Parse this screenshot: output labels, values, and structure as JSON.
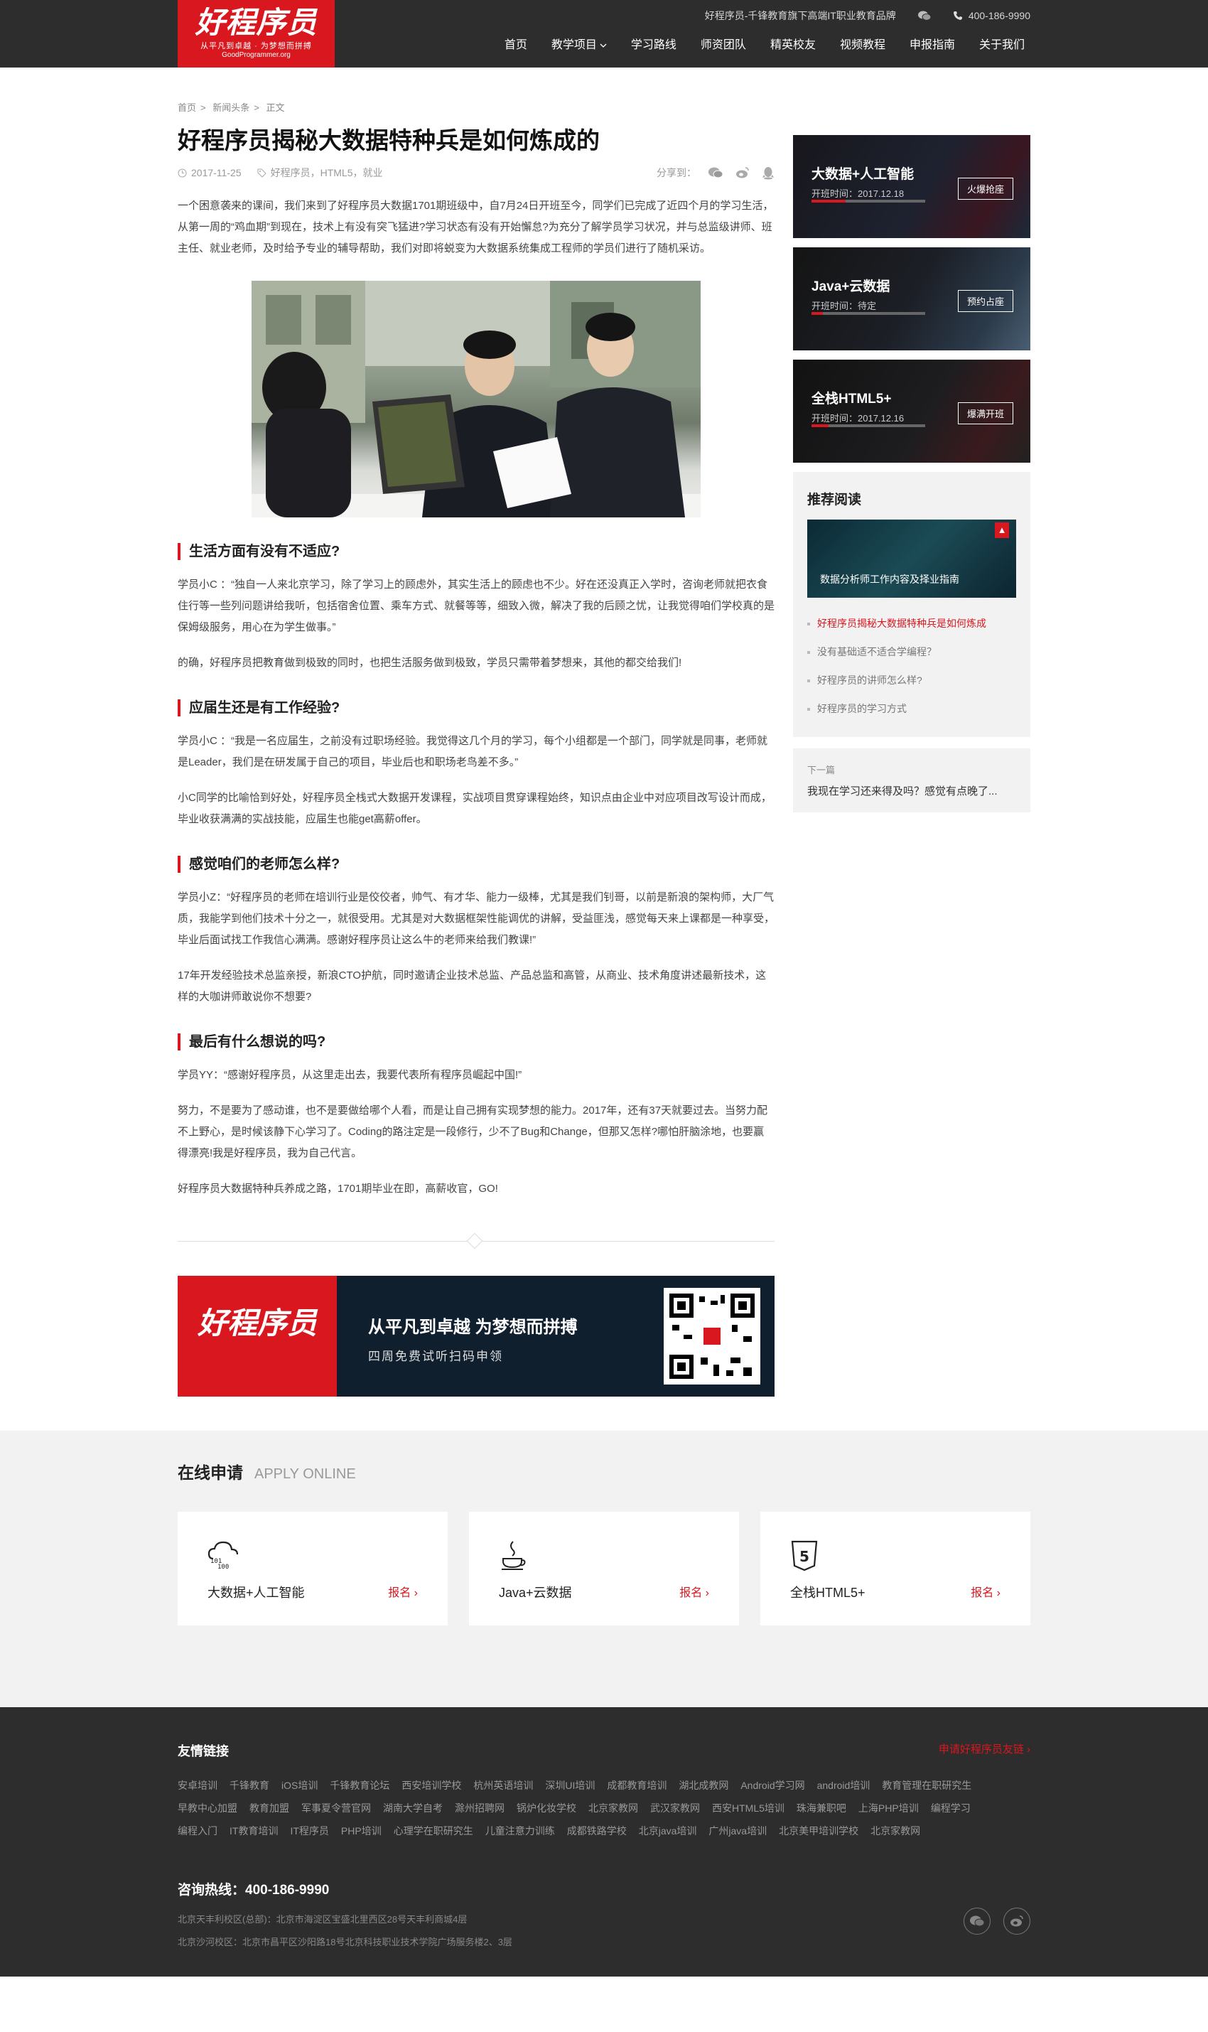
{
  "header": {
    "logo_text": "好程序员",
    "logo_slogan": "从平凡到卓越 · 为梦想而拼搏",
    "logo_url": "GoodProgrammer.org",
    "tagline": "好程序员-千锋教育旗下高端IT职业教育品牌",
    "phone": "400-186-9990",
    "nav": [
      "首页",
      "教学项目",
      "学习路线",
      "师资团队",
      "精英校友",
      "视频教程",
      "申报指南",
      "关于我们"
    ]
  },
  "breadcrumb": [
    "首页",
    "新闻头条",
    "正文"
  ],
  "article": {
    "title": "好程序员揭秘大数据特种兵是如何炼成的",
    "date": "2017-11-25",
    "tags": "好程序员，HTML5，就业",
    "share_label": "分享到：",
    "intro": "一个困意袭来的课间，我们来到了好程序员大数据1701期班级中，自7月24日开班至今，同学们已完成了近四个月的学习生活，从第一周的“鸡血期”到现在，技术上有没有突飞猛进?学习状态有没有开始懈怠?为充分了解学员学习状况，并与总监级讲师、班主任、就业老师，及时给予专业的辅导帮助，我们对即将蜕变为大数据系统集成工程师的学员们进行了随机采访。",
    "sections": [
      {
        "heading": "生活方面有没有不适应?",
        "paras": [
          "学员小C ：“独自一人来北京学习，除了学习上的顾虑外，其实生活上的顾虑也不少。好在还没真正入学时，咨询老师就把衣食住行等一些列问题讲给我听，包括宿舍位置、乘车方式、就餐等等，细致入微，解决了我的后顾之忧，让我觉得咱们学校真的是保姆级服务，用心在为学生做事。”",
          "的确，好程序员把教育做到极致的同时，也把生活服务做到极致，学员只需带着梦想来，其他的都交给我们!"
        ]
      },
      {
        "heading": "应届生还是有工作经验?",
        "paras": [
          "学员小C ：“我是一名应届生，之前没有过职场经验。我觉得这几个月的学习，每个小组都是一个部门，同学就是同事，老师就是Leader，我们是在研发属于自己的项目，毕业后也和职场老鸟差不多。”",
          "小C同学的比喻恰到好处，好程序员全栈式大数据开发课程，实战项目贯穿课程始终，知识点由企业中对应项目改写设计而成，毕业收获满满的实战技能，应届生也能get高薪offer。"
        ]
      },
      {
        "heading": "感觉咱们的老师怎么样?",
        "paras": [
          "学员小Z：“好程序员的老师在培训行业是佼佼者，帅气、有才华、能力一级棒，尤其是我们钊哥，以前是新浪的架构师，大厂气质，我能学到他们技术十分之一，就很受用。尤其是对大数据框架性能调优的讲解，受益匪浅，感觉每天来上课都是一种享受，毕业后面试找工作我信心满满。感谢好程序员让这么牛的老师来给我们教课!”",
          "17年开发经验技术总监亲授，新浪CTO护航，同时邀请企业技术总监、产品总监和高管，从商业、技术角度讲述最新技术，这样的大咖讲师敢说你不想要?"
        ]
      },
      {
        "heading": "最后有什么想说的吗?",
        "paras": [
          "学员YY：“感谢好程序员，从这里走出去，我要代表所有程序员崛起中国!”",
          "努力，不是要为了感动谁，也不是要做给哪个人看，而是让自己拥有实现梦想的能力。2017年，还有37天就要过去。当努力配不上野心，是时候该静下心学习了。Coding的路注定是一段修行，少不了Bug和Change，但那又怎样?哪怕肝脑涂地，也要赢得漂亮!我是好程序员，我为自己代言。",
          "好程序员大数据特种兵养成之路，1701期毕业在即，高薪收官，GO!"
        ]
      }
    ],
    "banner": {
      "logo_text": "好程序员",
      "line1": "从平凡到卓越  为梦想而拼搏",
      "line2": "四周免费试听扫码申领"
    }
  },
  "sidebar": {
    "courses": [
      {
        "name": "大数据+人工智能",
        "date_label": "开班时间：",
        "date": "2017.12.18",
        "button": "火爆抢座",
        "progress": 0.3
      },
      {
        "name": "Java+云数据",
        "date_label": "开班时间：",
        "date": "待定",
        "button": "预约占座",
        "progress": 0.1
      },
      {
        "name": "全栈HTML5+",
        "date_label": "开班时间：",
        "date": "2017.12.16",
        "button": "爆满开班",
        "progress": 0.15
      }
    ],
    "recommend": {
      "title": "推荐阅读",
      "image_caption": "数据分析师工作内容及择业指南",
      "items": [
        "好程序员揭秘大数据特种兵是如何炼成",
        "没有基础适不适合学编程？",
        "好程序员的讲师怎么样?",
        "好程序员的学习方式"
      ]
    },
    "next": {
      "label": "下一篇",
      "title": "我现在学习还来得及吗？感觉有点晚了..."
    }
  },
  "apply": {
    "title": "在线申请",
    "subtitle": "APPLY ONLINE",
    "cards": [
      {
        "name": "大数据+人工智能",
        "button": "报名",
        "icon": "cloud-data-icon"
      },
      {
        "name": "Java+云数据",
        "button": "报名",
        "icon": "java-cup-icon"
      },
      {
        "name": "全栈HTML5+",
        "button": "报名",
        "icon": "html5-shield-icon"
      }
    ]
  },
  "footer": {
    "links_title": "友情链接",
    "apply_link": "申请好程序员友链",
    "links": [
      "安卓培训",
      "千锋教育",
      "iOS培训",
      "千锋教育论坛",
      "西安培训学校",
      "杭州英语培训",
      "深圳UI培训",
      "成都教育培训",
      "湖北成教网",
      "Android学习网",
      "android培训",
      "教育管理在职研究生",
      "早教中心加盟",
      "教育加盟",
      "军事夏令营官网",
      "湖南大学自考",
      "滁州招聘网",
      "锅炉化妆学校",
      "北京家教网",
      "武汉家教网",
      "西安HTML5培训",
      "珠海兼职吧",
      "上海PHP培训",
      "编程学习",
      "编程入门",
      "IT教育培训",
      "IT程序员",
      "PHP培训",
      "心理学在职研究生",
      "儿童注意力训练",
      "成都铁路学校",
      "北京java培训",
      "广州java培训",
      "北京美甲培训学校",
      "北京家教网"
    ],
    "hotline": "咨询热线：400-186-9990",
    "address1": "北京天丰利校区(总部)：北京市海淀区宝盛北里西区28号天丰利商城4层",
    "address2": "北京沙河校区：北京市昌平区沙阳路18号北京科技职业技术学院广场服务楼2、3层"
  },
  "colors": {
    "brand_red": "#d8171e",
    "dark": "#2d2d2d",
    "light_bg": "#f2f2f2"
  }
}
